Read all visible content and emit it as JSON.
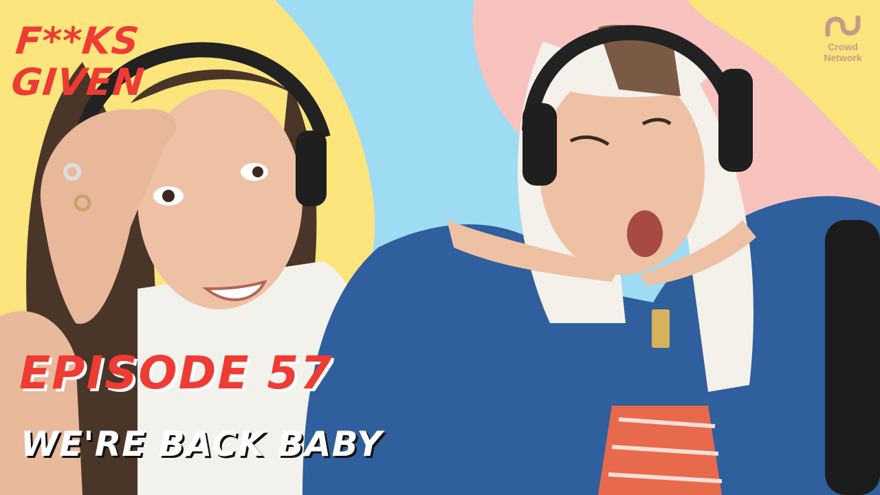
{
  "show": {
    "logo_text": "F**KS GIVEN",
    "episode_title": "EPISODE 57",
    "episode_subtitle": "WE'RE BACK BABY"
  },
  "brand": {
    "icon": "crowd-network-logo-icon",
    "line1": "Crowd",
    "line2": "Network"
  },
  "colors": {
    "yellow": "#fce57d",
    "blue": "#9edcf3",
    "pink": "#f8c2bf",
    "red_title": "#ee3b33",
    "denim": "#2f5f9c",
    "brand": "#c59a88"
  }
}
